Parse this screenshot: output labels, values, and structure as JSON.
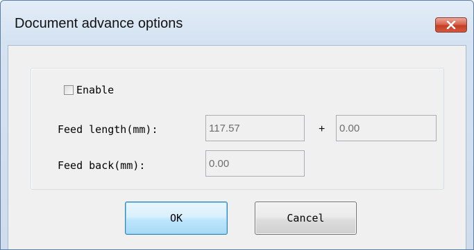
{
  "window": {
    "title": "Document advance options"
  },
  "enable": {
    "label": "Enable",
    "checked": false
  },
  "feed_length": {
    "label": "Feed length(mm):",
    "value": "117.57",
    "operator": "+",
    "offset_value": "0.00"
  },
  "feed_back": {
    "label": "Feed back(mm):",
    "value": "0.00"
  },
  "buttons": {
    "ok": "OK",
    "cancel": "Cancel"
  },
  "icons": {
    "close": "close-icon"
  },
  "colors": {
    "title_bar": "#d4e2f1",
    "close_button": "#c33e26",
    "dialog_body": "#f0f0f0",
    "ok_button_border": "#3c7fb1"
  }
}
